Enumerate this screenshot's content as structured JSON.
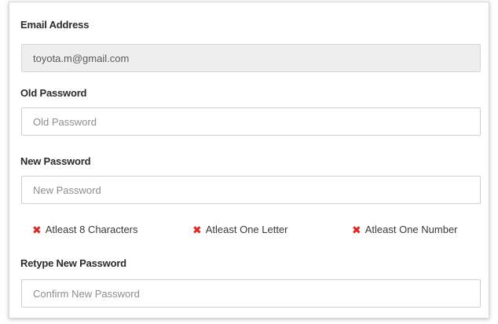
{
  "form": {
    "email": {
      "label": "Email Address",
      "value": "toyota.m@gmail.com"
    },
    "old_password": {
      "label": "Old Password",
      "placeholder": "Old Password"
    },
    "new_password": {
      "label": "New Password",
      "placeholder": "New Password"
    },
    "requirements": [
      {
        "icon": "x-icon",
        "text": "Atleast 8 Characters",
        "status": "unmet",
        "color": "#e0261f"
      },
      {
        "icon": "x-icon",
        "text": "Atleast One Letter",
        "status": "unmet",
        "color": "#e0261f"
      },
      {
        "icon": "x-icon",
        "text": "Atleast One Number",
        "status": "unmet",
        "color": "#e0261f"
      }
    ],
    "retype_password": {
      "label": "Retype New Password",
      "placeholder": "Confirm New Password"
    }
  }
}
